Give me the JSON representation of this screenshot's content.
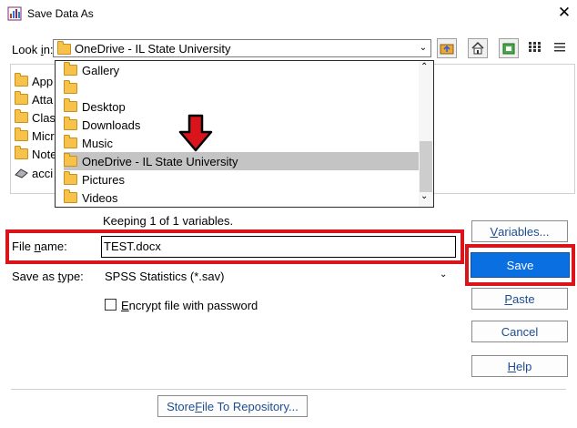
{
  "window": {
    "title": "Save Data As",
    "close_glyph": "✕"
  },
  "look_in": {
    "label": "Look in:",
    "value": "OneDrive - IL State University"
  },
  "toolbar": {
    "icons": [
      "up-folder-icon",
      "home-icon",
      "new-folder-icon",
      "list-view-icon"
    ]
  },
  "file_list": {
    "items": [
      "App",
      "Atta",
      "Clas",
      "Micr",
      "Note",
      "acci"
    ]
  },
  "dropdown": {
    "items": [
      "Gallery",
      "",
      "Desktop",
      "Downloads",
      "Music",
      "OneDrive - IL State University",
      "Pictures",
      "Videos"
    ],
    "selected_index": 5
  },
  "info": {
    "text": "Keeping 1 of 1 variables."
  },
  "file_name": {
    "label_pre": "File ",
    "label_u": "n",
    "label_post": "ame:",
    "value": "TEST.docx"
  },
  "save_type": {
    "label_pre": "Save as ",
    "label_u": "t",
    "label_post": "ype:",
    "value": "SPSS Statistics (*.sav)"
  },
  "encrypt": {
    "label_u": "E",
    "label_post": "ncrypt file with password",
    "checked": false
  },
  "buttons": {
    "variables_u": "V",
    "variables_post": "ariables...",
    "save": "Save",
    "paste_u": "P",
    "paste_post": "aste",
    "cancel": "Cancel",
    "help_u": "H",
    "help_post": "elp",
    "store_pre": "Store ",
    "store_u": "F",
    "store_post": "ile To Repository..."
  },
  "annotation": {
    "highlight_color": "#d9141b",
    "arrow_color": "#d9141b"
  }
}
